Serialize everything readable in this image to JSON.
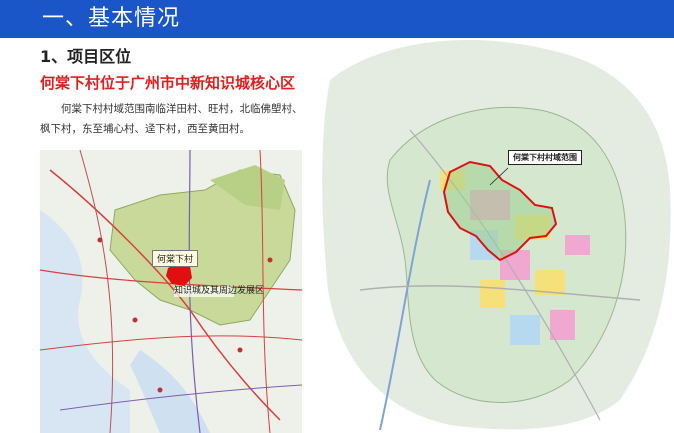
{
  "header": {
    "title": "一、基本情况",
    "color": "#1a56c8"
  },
  "section": {
    "title": "1、项目区位"
  },
  "headline": {
    "text": "何棠下村位于广州市中新知识城核心区",
    "color": "#e02020"
  },
  "body": {
    "text": "何棠下村村域范围南临洋田村、旺村，北临佛塱村、枫下村，东至埔心村、迳下村，西至黄田村。"
  },
  "left_map": {
    "label_village": "何棠下村",
    "label_core": "知识城及其周边发展区"
  },
  "right_map": {
    "label_boundary": "何棠下村村域范围"
  }
}
